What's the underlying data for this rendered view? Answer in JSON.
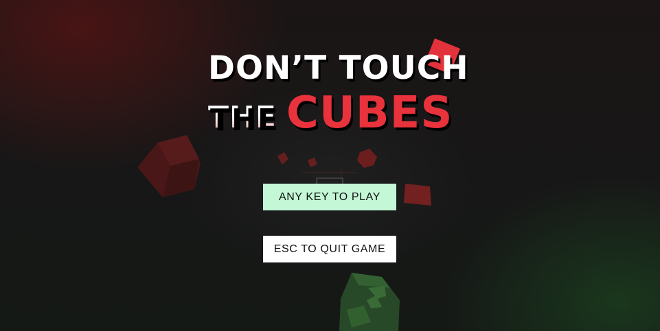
{
  "title": {
    "line1": "DON’T TOUCH",
    "line2_prefix": "THE",
    "line2_highlight": "CUBES"
  },
  "buttons": {
    "play_label": "ANY KEY TO PLAY",
    "quit_label": "ESC TO QUIT GAME"
  },
  "colors": {
    "background": "#171717",
    "accent_red": "#e8323c",
    "play_button": "#c3f7d6",
    "quit_button": "#ffffff",
    "green_cube": "#3e7a3a"
  }
}
